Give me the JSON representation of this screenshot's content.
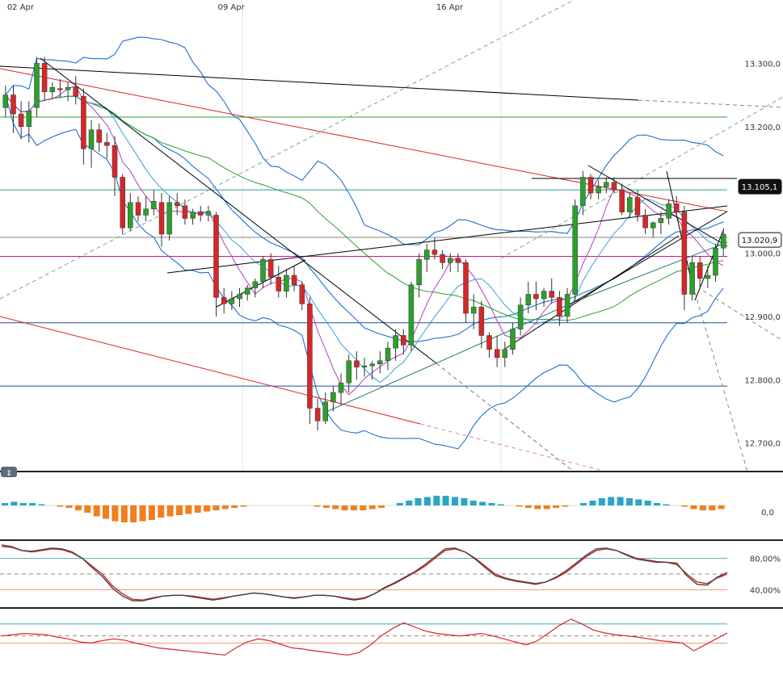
{
  "chart_data": [
    {
      "type": "candlestick",
      "x_ticks": [
        "02 Apr",
        "09 Apr",
        "16 Apr"
      ],
      "y_ticks": [
        "13.300,0",
        "13.200,0",
        "13.100,0",
        "13.000,0",
        "12.900,0",
        "12.800,0",
        "12.700,0"
      ],
      "y_tick_values": [
        13300,
        13200,
        13100,
        13000,
        12900,
        12800,
        12700
      ],
      "ylim": [
        12655,
        13400
      ],
      "price_labels": [
        {
          "value": 13105.1,
          "text": "13.105,1",
          "bg": "#111111"
        },
        {
          "value": 13020.9,
          "text": "13.020,9",
          "bg": "#ffffff"
        }
      ],
      "horizontal_levels": [
        {
          "value": 13215,
          "color": "#2ca02c"
        },
        {
          "value": 13100,
          "color": "#2a9d9d"
        },
        {
          "value": 12995,
          "color": "#c71585"
        },
        {
          "value": 13025,
          "color": "#888888"
        },
        {
          "value": 12890,
          "color": "#1f4fa0"
        },
        {
          "value": 12790,
          "color": "#1f4fa0"
        }
      ],
      "candle_colors": {
        "up": "#2ca02c",
        "down": "#d62728"
      },
      "candles": [
        [
          13230,
          13265,
          13215,
          13250
        ],
        [
          13250,
          13265,
          13190,
          13220
        ],
        [
          13220,
          13240,
          13180,
          13200
        ],
        [
          13200,
          13240,
          13175,
          13225
        ],
        [
          13230,
          13310,
          13215,
          13300
        ],
        [
          13300,
          13310,
          13240,
          13255
        ],
        [
          13255,
          13270,
          13245,
          13262
        ],
        [
          13260,
          13275,
          13245,
          13258
        ],
        [
          13258,
          13270,
          13240,
          13262
        ],
        [
          13262,
          13280,
          13235,
          13248
        ],
        [
          13248,
          13260,
          13140,
          13165
        ],
        [
          13165,
          13210,
          13135,
          13195
        ],
        [
          13195,
          13205,
          13160,
          13175
        ],
        [
          13175,
          13190,
          13150,
          13170
        ],
        [
          13170,
          13185,
          13090,
          13120
        ],
        [
          13120,
          13125,
          13030,
          13040
        ],
        [
          13040,
          13095,
          13035,
          13080
        ],
        [
          13080,
          13090,
          13050,
          13060
        ],
        [
          13060,
          13090,
          13050,
          13070
        ],
        [
          13070,
          13100,
          13060,
          13082
        ],
        [
          13080,
          13095,
          13010,
          13030
        ],
        [
          13030,
          13090,
          13020,
          13080
        ],
        [
          13080,
          13095,
          13060,
          13075
        ],
        [
          13075,
          13085,
          13045,
          13055
        ],
        [
          13055,
          13070,
          13045,
          13065
        ],
        [
          13065,
          13075,
          13050,
          13060
        ],
        [
          13060,
          13075,
          13050,
          13066
        ],
        [
          13060,
          13065,
          12900,
          12930
        ],
        [
          12930,
          12945,
          12905,
          12920
        ],
        [
          12920,
          12940,
          12910,
          12928
        ],
        [
          12928,
          12945,
          12915,
          12935
        ],
        [
          12935,
          12950,
          12925,
          12945
        ],
        [
          12945,
          12960,
          12930,
          12955
        ],
        [
          12955,
          12995,
          12945,
          12990
        ],
        [
          12990,
          13000,
          12950,
          12962
        ],
        [
          12962,
          12980,
          12930,
          12940
        ],
        [
          12940,
          12975,
          12930,
          12965
        ],
        [
          12965,
          12980,
          12940,
          12950
        ],
        [
          12950,
          12955,
          12910,
          12920
        ],
        [
          12920,
          12930,
          12730,
          12755
        ],
        [
          12755,
          12770,
          12720,
          12735
        ],
        [
          12735,
          12780,
          12730,
          12765
        ],
        [
          12765,
          12790,
          12750,
          12780
        ],
        [
          12780,
          12810,
          12760,
          12795
        ],
        [
          12795,
          12840,
          12780,
          12830
        ],
        [
          12830,
          12845,
          12800,
          12820
        ],
        [
          12820,
          12835,
          12805,
          12822
        ],
        [
          12822,
          12830,
          12800,
          12825
        ],
        [
          12825,
          12845,
          12810,
          12830
        ],
        [
          12830,
          12860,
          12815,
          12850
        ],
        [
          12850,
          12880,
          12830,
          12870
        ],
        [
          12870,
          12880,
          12840,
          12855
        ],
        [
          12855,
          12955,
          12845,
          12950
        ],
        [
          12950,
          13000,
          12930,
          12990
        ],
        [
          12990,
          13015,
          12970,
          13005
        ],
        [
          13005,
          13025,
          12990,
          12998
        ],
        [
          12998,
          13005,
          12975,
          12985
        ],
        [
          12985,
          13000,
          12970,
          12992
        ],
        [
          12992,
          13000,
          12970,
          12985
        ],
        [
          12985,
          12990,
          12890,
          12905
        ],
        [
          12905,
          12935,
          12880,
          12915
        ],
        [
          12915,
          12925,
          12850,
          12870
        ],
        [
          12870,
          12875,
          12835,
          12848
        ],
        [
          12848,
          12870,
          12820,
          12835
        ],
        [
          12835,
          12860,
          12820,
          12848
        ],
        [
          12848,
          12890,
          12840,
          12880
        ],
        [
          12880,
          12930,
          12870,
          12918
        ],
        [
          12918,
          12955,
          12905,
          12935
        ],
        [
          12935,
          12955,
          12910,
          12928
        ],
        [
          12928,
          12945,
          12915,
          12940
        ],
        [
          12940,
          12960,
          12920,
          12930
        ],
        [
          12930,
          12940,
          12885,
          12900
        ],
        [
          12900,
          12945,
          12890,
          12935
        ],
        [
          12935,
          13085,
          12925,
          13075
        ],
        [
          13075,
          13130,
          13060,
          13120
        ],
        [
          13120,
          13125,
          13085,
          13095
        ],
        [
          13095,
          13115,
          13085,
          13105
        ],
        [
          13105,
          13120,
          13095,
          13112
        ],
        [
          13112,
          13120,
          13095,
          13100
        ],
        [
          13100,
          13110,
          13060,
          13065
        ],
        [
          13065,
          13095,
          13055,
          13088
        ],
        [
          13088,
          13100,
          13050,
          13060
        ],
        [
          13060,
          13070,
          13030,
          13040
        ],
        [
          13040,
          13050,
          13025,
          13048
        ],
        [
          13048,
          13065,
          13030,
          13055
        ],
        [
          13055,
          13085,
          13045,
          13078
        ],
        [
          13078,
          13090,
          13060,
          13065
        ],
        [
          13065,
          13075,
          12910,
          12935
        ],
        [
          12935,
          12995,
          12925,
          12985
        ],
        [
          12985,
          12995,
          12945,
          12960
        ],
        [
          12960,
          12980,
          12945,
          12965
        ],
        [
          12965,
          13015,
          12955,
          13008
        ],
        [
          13008,
          13035,
          12995,
          13030
        ]
      ],
      "date_label_candle_index": [
        0,
        27,
        55
      ]
    },
    {
      "type": "histogram",
      "ylabels": [
        "0,0"
      ],
      "up_color": "#2aa6c4",
      "down_color": "#f07f1e",
      "values": [
        2,
        3,
        2,
        2,
        1,
        0,
        -1,
        -2,
        -4,
        -6,
        -9,
        -11,
        -13,
        -14,
        -14,
        -13,
        -12,
        -10,
        -9,
        -8,
        -7,
        -6,
        -5,
        -4,
        -3,
        -2,
        -1,
        0,
        0,
        0,
        0,
        0,
        0,
        0,
        -1,
        -2,
        -3,
        -4,
        -4,
        -4,
        -3,
        -2,
        0,
        2,
        4,
        6,
        7,
        8,
        8,
        7,
        6,
        4,
        3,
        2,
        1,
        0,
        -1,
        -2,
        -3,
        -3,
        -2,
        -1,
        0,
        2,
        4,
        6,
        7,
        7,
        6,
        5,
        4,
        2,
        1,
        0,
        -1,
        -3,
        -4,
        -4,
        -3
      ]
    },
    {
      "type": "line",
      "ylabels": [
        "80,00%",
        "40,00%"
      ],
      "level_values": [
        80,
        40
      ],
      "ylim": [
        20,
        100
      ],
      "series": [
        {
          "color": "#d62728",
          "values": [
            95,
            94,
            90,
            88,
            90,
            92,
            91,
            87,
            80,
            70,
            60,
            45,
            35,
            28,
            27,
            30,
            32,
            33,
            33,
            32,
            30,
            28,
            30,
            32,
            34,
            36,
            35,
            33,
            31,
            30,
            31,
            33,
            33,
            32,
            30,
            28,
            30,
            35,
            42,
            48,
            55,
            62,
            70,
            80,
            90,
            92,
            88,
            80,
            70,
            60,
            55,
            52,
            50,
            48,
            50,
            55,
            62,
            72,
            82,
            90,
            92,
            90,
            85,
            80,
            78,
            76,
            75,
            72,
            60,
            50,
            48,
            55,
            60
          ]
        },
        {
          "color": "#444444",
          "values": [
            97,
            95,
            90,
            89,
            91,
            93,
            92,
            88,
            80,
            68,
            57,
            42,
            32,
            26,
            26,
            29,
            32,
            33,
            33,
            31,
            29,
            27,
            29,
            32,
            34,
            36,
            35,
            33,
            31,
            29,
            31,
            33,
            33,
            32,
            29,
            27,
            29,
            35,
            43,
            49,
            56,
            63,
            72,
            82,
            92,
            93,
            88,
            79,
            68,
            58,
            54,
            51,
            49,
            47,
            50,
            56,
            64,
            74,
            84,
            92,
            93,
            90,
            84,
            79,
            77,
            75,
            75,
            74,
            58,
            47,
            46,
            56,
            62
          ]
        }
      ]
    },
    {
      "type": "line",
      "level_values": [
        80,
        60
      ],
      "ylim": [
        0,
        100
      ],
      "series": [
        {
          "color": "#d62728",
          "values": [
            60,
            62,
            64,
            63,
            62,
            58,
            55,
            50,
            48,
            52,
            55,
            53,
            48,
            44,
            40,
            38,
            36,
            34,
            32,
            30,
            28,
            40,
            50,
            55,
            52,
            46,
            40,
            38,
            35,
            33,
            30,
            28,
            32,
            44,
            60,
            72,
            82,
            75,
            68,
            64,
            62,
            60,
            62,
            64,
            60,
            55,
            50,
            45,
            52,
            65,
            78,
            88,
            80,
            70,
            65,
            62,
            60,
            58,
            55,
            52,
            50,
            48,
            35,
            45,
            55,
            65
          ]
        }
      ]
    }
  ]
}
